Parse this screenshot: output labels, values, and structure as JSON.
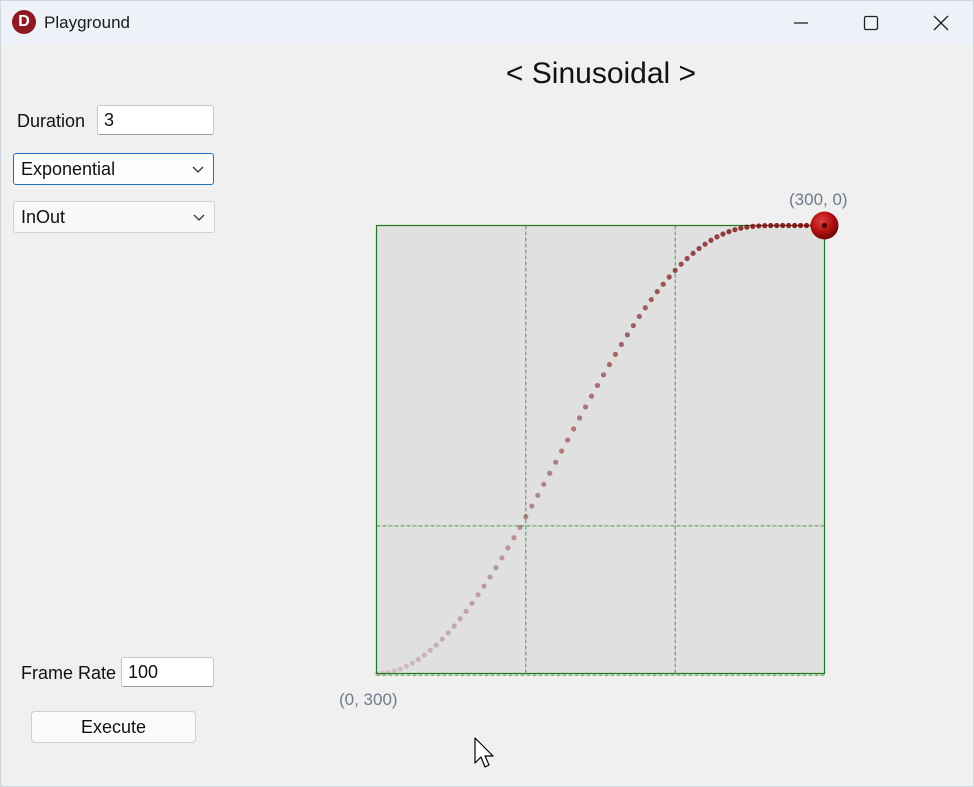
{
  "window": {
    "title": "Playground",
    "app_icon_letter": "D",
    "app_icon_color": "#8e1b22",
    "controls": [
      "minimize-icon",
      "maximize-icon",
      "close-icon"
    ]
  },
  "controls": {
    "duration_label": "Duration",
    "duration_value": "3",
    "easing_type": "Exponential",
    "easing_mode": "InOut",
    "frame_rate_label": "Frame Rate",
    "frame_rate_value": "100",
    "execute_label": "Execute"
  },
  "chart": {
    "heading": "< Sinusoidal >",
    "start_label": "(0, 300)",
    "end_label": "(300, 0)",
    "colors": {
      "plot_background": "#e0e0e0",
      "border": "#1f7a1f",
      "gridlines": "#4a9a4a",
      "point": "#7d1212",
      "ball": "#b41010"
    }
  },
  "chart_data": {
    "type": "scatter",
    "title": "< Sinusoidal >",
    "xlim": [
      0,
      300
    ],
    "ylim": [
      0,
      300
    ],
    "y_axis_inverted": true,
    "grid": true,
    "grid_divisions": 3,
    "annotations": [
      "(0, 300)",
      "(300, 0)"
    ],
    "series": [
      {
        "x": [
          0,
          4,
          8,
          12,
          16,
          20,
          24,
          28,
          32,
          36,
          40,
          44,
          48,
          52,
          56,
          60,
          64,
          68,
          72,
          76,
          80,
          84,
          88,
          92,
          96,
          100,
          104,
          108,
          112,
          116,
          120,
          124,
          128,
          132,
          136,
          140,
          144,
          148,
          152,
          156,
          160,
          164,
          168,
          172,
          176,
          180,
          184,
          188,
          192,
          196,
          200,
          204,
          208,
          212,
          216,
          220,
          224,
          228,
          232,
          236,
          240,
          244,
          248,
          252,
          256,
          260,
          264,
          268,
          272,
          276,
          280,
          284,
          288,
          292,
          296,
          300
        ],
        "y": [
          300.0,
          299.8,
          299.2,
          298.2,
          296.9,
          295.1,
          293.0,
          290.5,
          287.6,
          284.4,
          280.9,
          277.0,
          272.8,
          268.2,
          263.4,
          258.3,
          253.0,
          247.3,
          241.5,
          235.4,
          229.1,
          222.6,
          215.9,
          209.1,
          202.2,
          195.1,
          187.9,
          180.7,
          173.3,
          165.9,
          158.5,
          151.0,
          143.7,
          136.2,
          128.9,
          121.5,
          114.3,
          107.1,
          100.0,
          93.1,
          86.3,
          79.7,
          73.2,
          67.0,
          60.9,
          55.1,
          49.6,
          44.3,
          39.3,
          34.5,
          30.1,
          25.9,
          22.1,
          18.6,
          15.4,
          12.5,
          9.9,
          7.6,
          5.7,
          4.1,
          2.8,
          1.8,
          1.1,
          0.6,
          0.3,
          0.1,
          0.0,
          0.0,
          0.0,
          0.0,
          0.0,
          0.0,
          0.0,
          0.0,
          0.0,
          0.0
        ]
      }
    ]
  }
}
